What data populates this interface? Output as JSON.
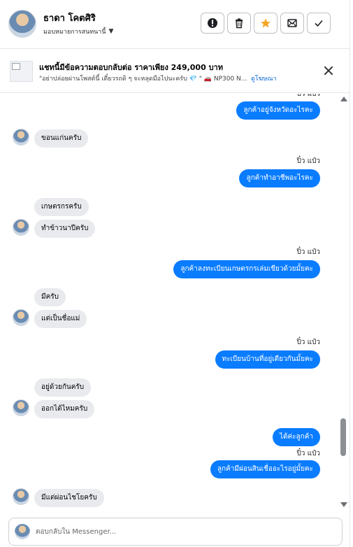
{
  "header": {
    "contact_name": "ธาดา โคตศิริ",
    "assign_label": "มอบหมายการสนทนานี้"
  },
  "ad_banner": {
    "title": "แชทนี้มีข้อความตอบกลับต่อ ราคาเพียง 249,000 บาท",
    "subtitle": "\"อย่าปล่อยผ่านโพสต์นี้ เดี๋ยวรถดิ ๆ จะหลุดมือไปนะครับ 💎 \" 🚗 NP300 N...",
    "link": "ดูโฆษณา"
  },
  "messages": [
    {
      "from": "page",
      "sender": "ปิ๋ว แป๋ว",
      "text": "ลูกค้าอยู่จังหวัดอะไรคะ"
    },
    {
      "from": "customer",
      "text": "ขอนแก่นครับ"
    },
    {
      "from": "page",
      "sender": "ปิ๋ว แป๋ว",
      "text": "ลูกค้าทำอาชีพอะไรคะ"
    },
    {
      "from": "customer",
      "text": "เกษตรกรครับ"
    },
    {
      "from": "customer",
      "text": "ทำข้าวนาปีครับ"
    },
    {
      "from": "page",
      "sender": "ปิ๋ว แป๋ว",
      "text": "ลูกค้าลงทะเบียนเกษตรกรเล่มเขียวด้วยมั้ยคะ"
    },
    {
      "from": "customer",
      "text": "มีครับ"
    },
    {
      "from": "customer",
      "text": "แต่เป็นชื่อแม่"
    },
    {
      "from": "page",
      "sender": "ปิ๋ว แป๋ว",
      "text": "ทะเบียนบ้านที่อยู่เดียวกันมั้ยคะ"
    },
    {
      "from": "customer",
      "text": "อยู่ด้วยกันครับ"
    },
    {
      "from": "customer",
      "text": "ออกได้ไหมครับ"
    },
    {
      "from": "page",
      "text": "ได้ค่ะลูกค้า"
    },
    {
      "from": "page",
      "sender": "ปิ๋ว แป๋ว",
      "text": "ลูกค้ามีผ่อนสินเชื่ออะไรอยู่มั้ยคะ"
    },
    {
      "from": "customer",
      "text": "มีแต่ผ่อนไชโยครับ"
    }
  ],
  "composer": {
    "placeholder": "ตอบกลับใน Messenger..."
  },
  "icons": {
    "spam": "exclamation-circle-icon",
    "delete": "trash-icon",
    "star": "star-icon",
    "mark_unread": "envelope-icon",
    "done": "check-icon"
  },
  "colors": {
    "outgoing_bubble": "#0a7cff",
    "incoming_bubble": "#e9eaee",
    "star_active": "#f5a623"
  }
}
